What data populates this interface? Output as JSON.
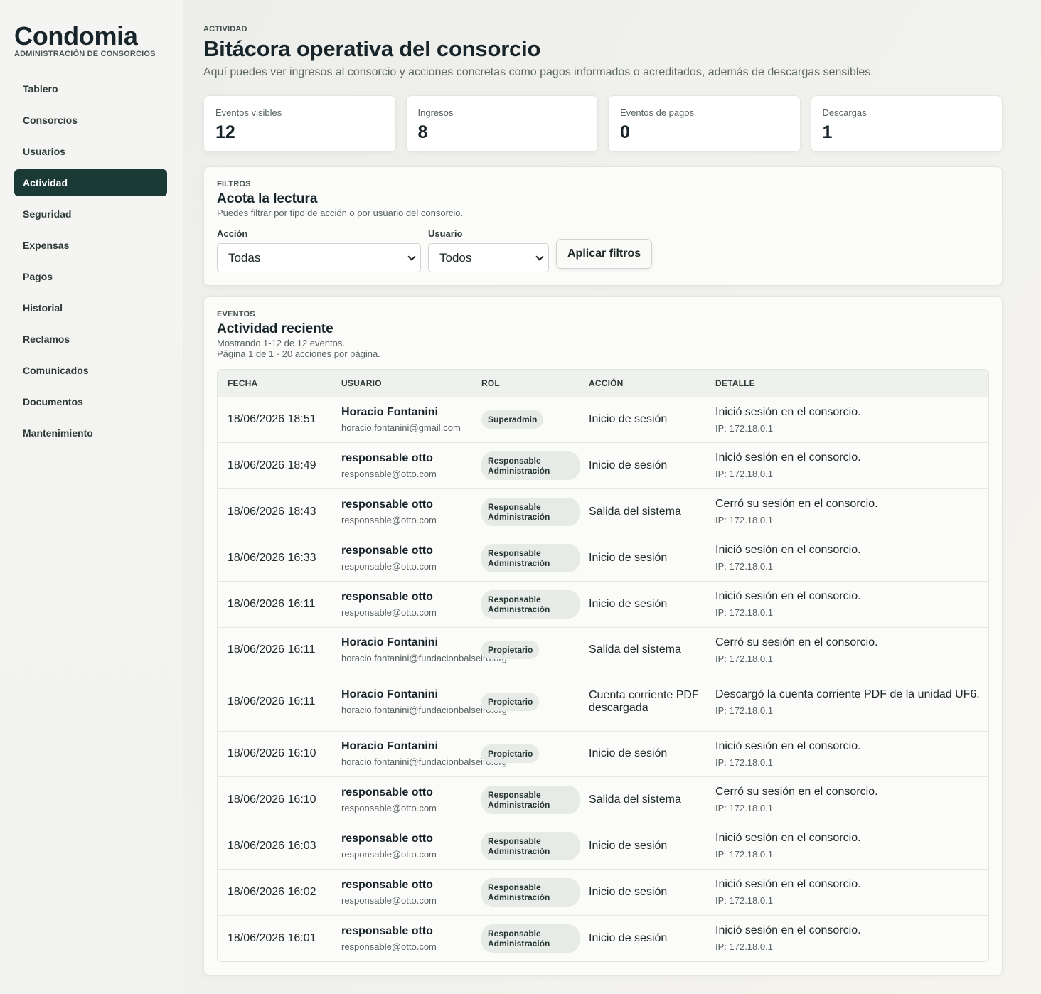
{
  "brand": {
    "name": "Condomia",
    "subtitle": "ADMINISTRACIÓN DE CONSORCIOS"
  },
  "nav": [
    {
      "label": "Tablero",
      "active": false
    },
    {
      "label": "Consorcios",
      "active": false
    },
    {
      "label": "Usuarios",
      "active": false
    },
    {
      "label": "Actividad",
      "active": true
    },
    {
      "label": "Seguridad",
      "active": false
    },
    {
      "label": "Expensas",
      "active": false
    },
    {
      "label": "Pagos",
      "active": false
    },
    {
      "label": "Historial",
      "active": false
    },
    {
      "label": "Reclamos",
      "active": false
    },
    {
      "label": "Comunicados",
      "active": false
    },
    {
      "label": "Documentos",
      "active": false
    },
    {
      "label": "Mantenimiento",
      "active": false
    }
  ],
  "page": {
    "eyebrow": "ACTIVIDAD",
    "title": "Bitácora operativa del consorcio",
    "description": "Aquí puedes ver ingresos al consorcio y acciones concretas como pagos informados o acreditados, además de descargas sensibles."
  },
  "stats": [
    {
      "label": "Eventos visibles",
      "value": "12"
    },
    {
      "label": "Ingresos",
      "value": "8"
    },
    {
      "label": "Eventos de pagos",
      "value": "0"
    },
    {
      "label": "Descargas",
      "value": "1"
    }
  ],
  "filters": {
    "eyebrow": "FILTROS",
    "title": "Acota la lectura",
    "subtitle": "Puedes filtrar por tipo de acción o por usuario del consorcio.",
    "action_label": "Acción",
    "action_value": "Todas",
    "user_label": "Usuario",
    "user_value": "Todos",
    "apply_label": "Aplicar filtros"
  },
  "events": {
    "eyebrow": "EVENTOS",
    "title": "Actividad reciente",
    "showing": "Mostrando 1-12 de 12 eventos.",
    "pagination": "Página 1 de 1 · 20 acciones por página.",
    "columns": [
      "FECHA",
      "USUARIO",
      "ROL",
      "ACCIÓN",
      "DETALLE"
    ],
    "rows": [
      {
        "date": "18/06/2026 18:51",
        "name": "Horacio Fontanini",
        "email": "horacio.fontanini@gmail.com",
        "role": "Superadmin",
        "action": "Inicio de sesión",
        "detail": "Inició sesión en el consorcio.",
        "ip": "IP: 172.18.0.1"
      },
      {
        "date": "18/06/2026 18:49",
        "name": "responsable otto",
        "email": "responsable@otto.com",
        "role": "Responsable Administración",
        "action": "Inicio de sesión",
        "detail": "Inició sesión en el consorcio.",
        "ip": "IP: 172.18.0.1"
      },
      {
        "date": "18/06/2026 18:43",
        "name": "responsable otto",
        "email": "responsable@otto.com",
        "role": "Responsable Administración",
        "action": "Salida del sistema",
        "detail": "Cerró su sesión en el consorcio.",
        "ip": "IP: 172.18.0.1"
      },
      {
        "date": "18/06/2026 16:33",
        "name": "responsable otto",
        "email": "responsable@otto.com",
        "role": "Responsable Administración",
        "action": "Inicio de sesión",
        "detail": "Inició sesión en el consorcio.",
        "ip": "IP: 172.18.0.1"
      },
      {
        "date": "18/06/2026 16:11",
        "name": "responsable otto",
        "email": "responsable@otto.com",
        "role": "Responsable Administración",
        "action": "Inicio de sesión",
        "detail": "Inició sesión en el consorcio.",
        "ip": "IP: 172.18.0.1"
      },
      {
        "date": "18/06/2026 16:11",
        "name": "Horacio Fontanini",
        "email": "horacio.fontanini@fundacionbalseiro.org",
        "role": "Propietario",
        "action": "Salida del sistema",
        "detail": "Cerró su sesión en el consorcio.",
        "ip": "IP: 172.18.0.1"
      },
      {
        "date": "18/06/2026 16:11",
        "name": "Horacio Fontanini",
        "email": "horacio.fontanini@fundacionbalseiro.org",
        "role": "Propietario",
        "action": "Cuenta corriente PDF descargada",
        "detail": "Descargó la cuenta corriente PDF de la unidad UF6.",
        "ip": "IP: 172.18.0.1"
      },
      {
        "date": "18/06/2026 16:10",
        "name": "Horacio Fontanini",
        "email": "horacio.fontanini@fundacionbalseiro.org",
        "role": "Propietario",
        "action": "Inicio de sesión",
        "detail": "Inició sesión en el consorcio.",
        "ip": "IP: 172.18.0.1"
      },
      {
        "date": "18/06/2026 16:10",
        "name": "responsable otto",
        "email": "responsable@otto.com",
        "role": "Responsable Administración",
        "action": "Salida del sistema",
        "detail": "Cerró su sesión en el consorcio.",
        "ip": "IP: 172.18.0.1"
      },
      {
        "date": "18/06/2026 16:03",
        "name": "responsable otto",
        "email": "responsable@otto.com",
        "role": "Responsable Administración",
        "action": "Inicio de sesión",
        "detail": "Inició sesión en el consorcio.",
        "ip": "IP: 172.18.0.1"
      },
      {
        "date": "18/06/2026 16:02",
        "name": "responsable otto",
        "email": "responsable@otto.com",
        "role": "Responsable Administración",
        "action": "Inicio de sesión",
        "detail": "Inició sesión en el consorcio.",
        "ip": "IP: 172.18.0.1"
      },
      {
        "date": "18/06/2026 16:01",
        "name": "responsable otto",
        "email": "responsable@otto.com",
        "role": "Responsable Administración",
        "action": "Inicio de sesión",
        "detail": "Inició sesión en el consorcio.",
        "ip": "IP: 172.18.0.1"
      }
    ]
  }
}
